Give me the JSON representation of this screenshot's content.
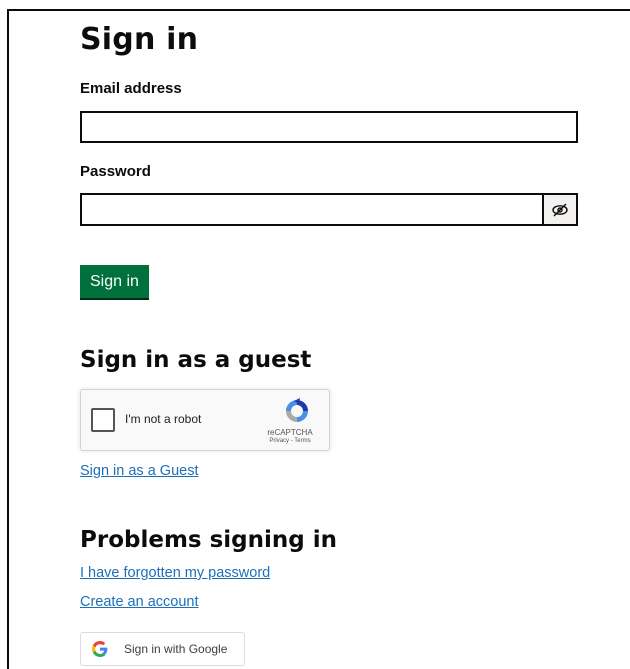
{
  "signin": {
    "title": "Sign in",
    "email_label": "Email address",
    "email_value": "",
    "password_label": "Password",
    "password_value": "",
    "button_label": "Sign in"
  },
  "guest": {
    "title": "Sign in as a guest",
    "captcha": {
      "label": "I'm not a robot",
      "brand": "reCAPTCHA",
      "privacy": "Privacy",
      "separator": " - ",
      "terms": "Terms"
    },
    "link_label": "Sign in as a Guest"
  },
  "problems": {
    "title": "Problems signing in",
    "forgot_link": "I have forgotten my password",
    "create_link": "Create an account"
  },
  "google": {
    "button_label": "Sign in with Google"
  },
  "icons": {
    "password_toggle": "eye-slash-icon",
    "captcha": "recaptcha-logo-icon",
    "google": "google-g-icon"
  },
  "colors": {
    "primary_button": "#00703c",
    "link": "#1d70b8",
    "text": "#0b0c0c"
  }
}
